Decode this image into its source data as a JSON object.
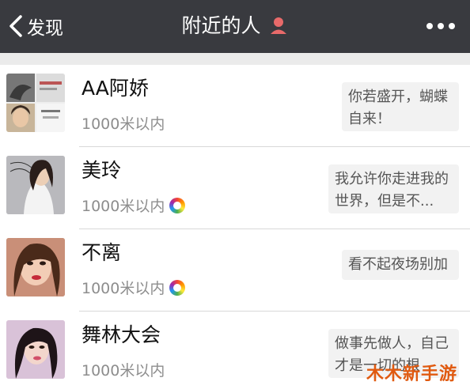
{
  "nav": {
    "back_label": "发现",
    "title": "附近的人",
    "back_icon": "chevron-left-icon",
    "more_icon": "more-dots-icon",
    "gender_icon": "person-pin-icon"
  },
  "users": [
    {
      "name": "AA阿娇",
      "distance": "1000米以内",
      "signature": "你若盛开，蝴蝶自来！",
      "has_moments": false
    },
    {
      "name": "美玲",
      "distance": "1000米以内",
      "signature": "我允许你走进我的世界，但是不...",
      "has_moments": true
    },
    {
      "name": "不离",
      "distance": "1000米以内",
      "signature": "看不起夜场别加",
      "has_moments": true
    },
    {
      "name": "舞林大会",
      "distance": "1000米以内",
      "signature": "做事先做人，自己才是一切的根",
      "has_moments": false
    }
  ],
  "watermark": "木木新手游",
  "colors": {
    "nav_bg": "#393a3f",
    "separator": "#d8d8d8",
    "bubble": "#f2f2f2",
    "watermark": "#e05a10"
  }
}
